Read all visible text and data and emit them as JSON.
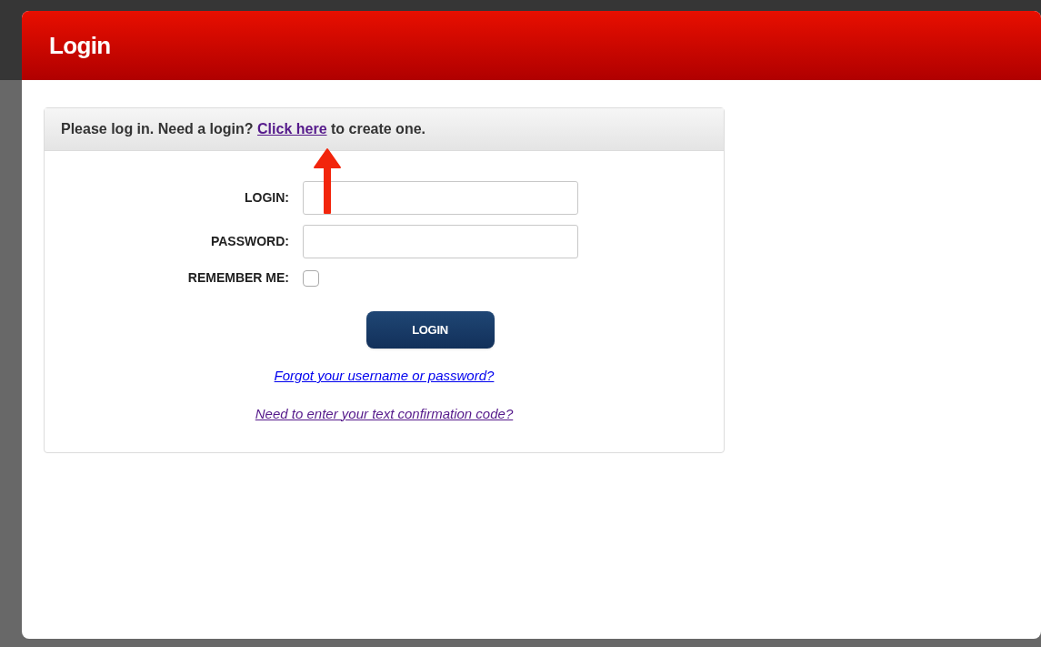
{
  "window": {
    "title": "Login"
  },
  "intro": {
    "text_before": "Please log in. Need a login?",
    "link": {
      "text": "Click here",
      "visited": true
    },
    "text_after": "to create one."
  },
  "fields": [
    {
      "kind": "text",
      "label": "LOGIN:"
    },
    {
      "kind": "password",
      "label": "PASSWORD:"
    },
    {
      "kind": "checkbox",
      "label": "REMEMBER ME:",
      "checked": false
    }
  ],
  "submit": "LOGIN",
  "links": [
    {
      "text": "Forgot your username or password?",
      "visited": false
    },
    {
      "text": "Need to enter your text confirmation code?",
      "visited": true
    }
  ]
}
